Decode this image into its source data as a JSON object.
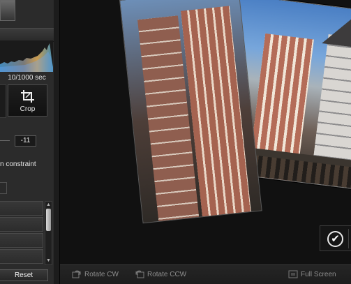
{
  "left_panel": {
    "shutter": "10/1000 sec",
    "crop_label": "Crop",
    "angle_value": "-11",
    "constraint_text": "n constraint",
    "reset_label": "Reset"
  },
  "overlay": {
    "accept_icon": "✔",
    "reject_icon": "✕"
  },
  "bottom": {
    "rotate_cw": "Rotate CW",
    "rotate_ccw": "Rotate CCW",
    "full_screen": "Full Screen"
  },
  "colors": {
    "panel": "#2b2b2b",
    "canvas": "#111111",
    "accent": "#ffffff"
  }
}
